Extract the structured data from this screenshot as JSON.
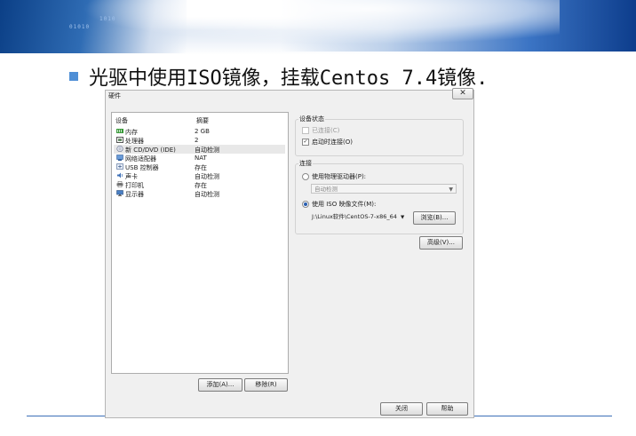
{
  "slide": {
    "title": "光驱中使用ISO镜像，挂载Centos 7.4镜像."
  },
  "dialog": {
    "title": "硬件",
    "close_glyph": "✕",
    "list": {
      "col_device": "设备",
      "col_summary": "摘要",
      "rows": [
        {
          "name": "内存",
          "summary": "2 GB",
          "icon": "memory-icon"
        },
        {
          "name": "处理器",
          "summary": "2",
          "icon": "processor-icon"
        },
        {
          "name": "新 CD/DVD (IDE)",
          "summary": "自动检测",
          "icon": "cd-dvd-icon",
          "selected": true
        },
        {
          "name": "网络适配器",
          "summary": "NAT",
          "icon": "network-adapter-icon"
        },
        {
          "name": "USB 控制器",
          "summary": "存在",
          "icon": "usb-icon"
        },
        {
          "name": "声卡",
          "summary": "自动检测",
          "icon": "sound-card-icon"
        },
        {
          "name": "打印机",
          "summary": "存在",
          "icon": "printer-icon"
        },
        {
          "name": "显示器",
          "summary": "自动检测",
          "icon": "display-icon"
        }
      ]
    },
    "add_button": "添加(A)...",
    "remove_button": "移除(R)",
    "device_status": {
      "legend": "设备状态",
      "connected": "已连接(C)",
      "connect_on_power_on": "启动时连接(O)"
    },
    "connection": {
      "legend": "连接",
      "use_physical": "使用物理驱动器(P):",
      "physical_value": "自动检测",
      "use_iso": "使用 ISO 映像文件(M):",
      "iso_path": "J:\\Linux软件\\CentOS-7-x86_64",
      "browse_button": "浏览(B)..."
    },
    "advanced_button": "高级(V)...",
    "close_button": "关闭",
    "help_button": "帮助"
  }
}
